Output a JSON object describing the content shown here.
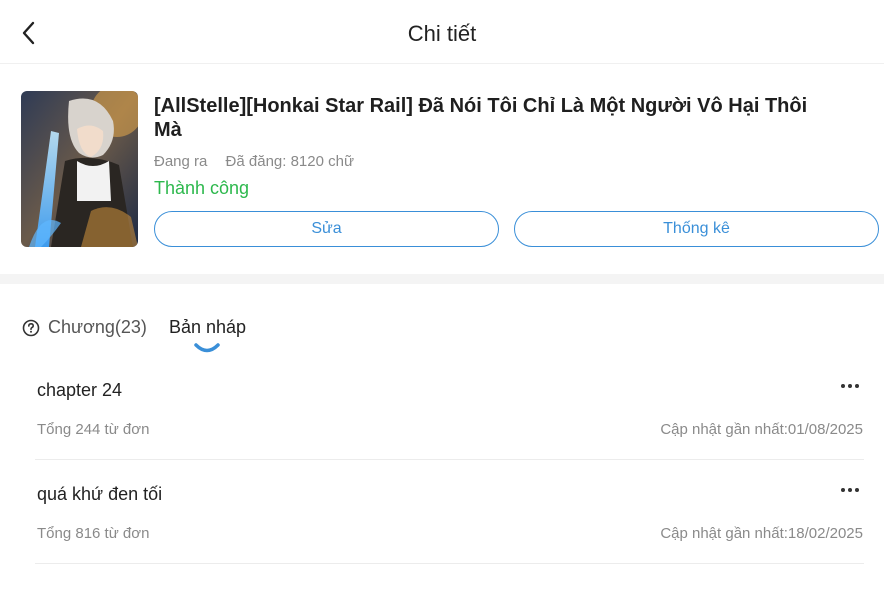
{
  "header": {
    "title": "Chi tiết"
  },
  "story": {
    "title": "[AllStelle][Honkai Star Rail] Đã Nói Tôi Chỉ Là Một Người Vô Hại Thôi Mà",
    "progress_status": "Đang ra",
    "posted_words": "Đã đăng: 8120 chữ",
    "review_status": "Thành công",
    "edit_label": "Sửa",
    "stats_label": "Thống kê"
  },
  "tabs": {
    "chapters_label": "Chương(23)",
    "drafts_label": "Bản nháp"
  },
  "drafts": [
    {
      "title": "chapter 24",
      "total": "Tổng 244 từ đơn",
      "updated": "Cập nhật gần nhất:01/08/2025"
    },
    {
      "title": "quá khứ đen tối",
      "total": "Tổng 816 từ đơn",
      "updated": "Cập nhật gần nhất:18/02/2025"
    }
  ],
  "icons": {
    "back": "chevron-left-icon",
    "help": "question-circle-icon",
    "more": "more-horizontal-icon"
  },
  "colors": {
    "accent": "#3a8fd8",
    "success": "#2db84d",
    "muted": "#8a8a8a"
  }
}
